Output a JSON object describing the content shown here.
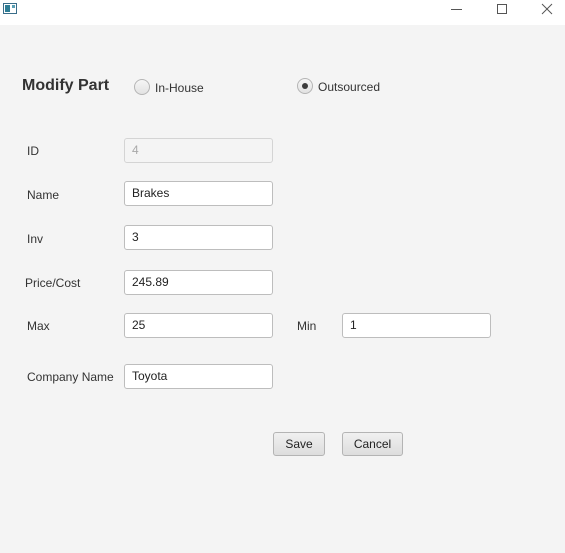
{
  "window": {
    "controls": {
      "minimize_icon": "minimize-icon",
      "maximize_icon": "maximize-icon",
      "close_icon": "close-icon"
    }
  },
  "form": {
    "title": "Modify Part",
    "source_options": [
      {
        "label": "In-House",
        "selected": false
      },
      {
        "label": "Outsourced",
        "selected": true
      }
    ],
    "fields": {
      "id": {
        "label": "ID",
        "value": "4",
        "disabled": true
      },
      "name": {
        "label": "Name",
        "value": "Brakes"
      },
      "inv": {
        "label": "Inv",
        "value": "3"
      },
      "price": {
        "label": "Price/Cost",
        "value": "245.89"
      },
      "max": {
        "label": "Max",
        "value": "25"
      },
      "min": {
        "label": "Min",
        "value": "1"
      },
      "company": {
        "label": "Company Name",
        "value": "Toyota"
      }
    },
    "buttons": {
      "save": "Save",
      "cancel": "Cancel"
    }
  },
  "colors": {
    "background": "#f4f4f4",
    "titlebar": "#ffffff",
    "text": "#333333",
    "field_border": "#bdbdbd"
  }
}
